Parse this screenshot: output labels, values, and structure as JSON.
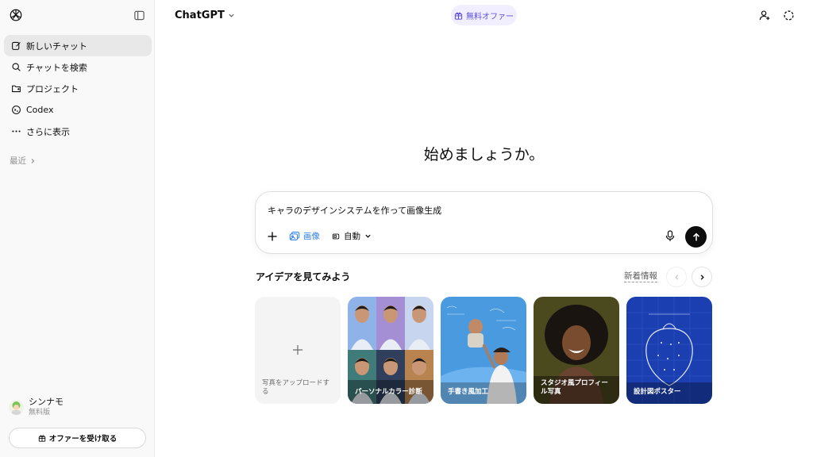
{
  "sidebar": {
    "items": [
      {
        "label": "新しいチャット",
        "icon": "edit-icon"
      },
      {
        "label": "チャットを検索",
        "icon": "search-icon"
      },
      {
        "label": "プロジェクト",
        "icon": "folder-icon"
      },
      {
        "label": "Codex",
        "icon": "codex-icon"
      },
      {
        "label": "さらに表示",
        "icon": "more-icon"
      }
    ],
    "recent_label": "最近",
    "user": {
      "name": "シンナモ",
      "plan": "無料版"
    },
    "offer_button": "オファーを受け取る"
  },
  "header": {
    "model_name": "ChatGPT",
    "free_offer": "無料オファー"
  },
  "main": {
    "greeting": "始めましょうか。",
    "composer": {
      "prompt_text": "キャラのデザインシステムを作って画像生成",
      "image_tool_label": "画像",
      "mode_label": "自動"
    },
    "ideas": {
      "title": "アイデアを見てみよう",
      "whats_new": "新着情報",
      "cards": [
        {
          "label": "写真をアップロードする"
        },
        {
          "label": "パーソナルカラー診断"
        },
        {
          "label": "手書き風加工"
        },
        {
          "label": "スタジオ風プロフィール写真"
        },
        {
          "label": "設計図ポスター"
        }
      ]
    }
  },
  "colors": {
    "sidebar_bg": "#f9f9f9",
    "accent_purple": "#5b4fd9",
    "accent_blue": "#2f7ef0",
    "send_button": "#0d0d0d"
  }
}
